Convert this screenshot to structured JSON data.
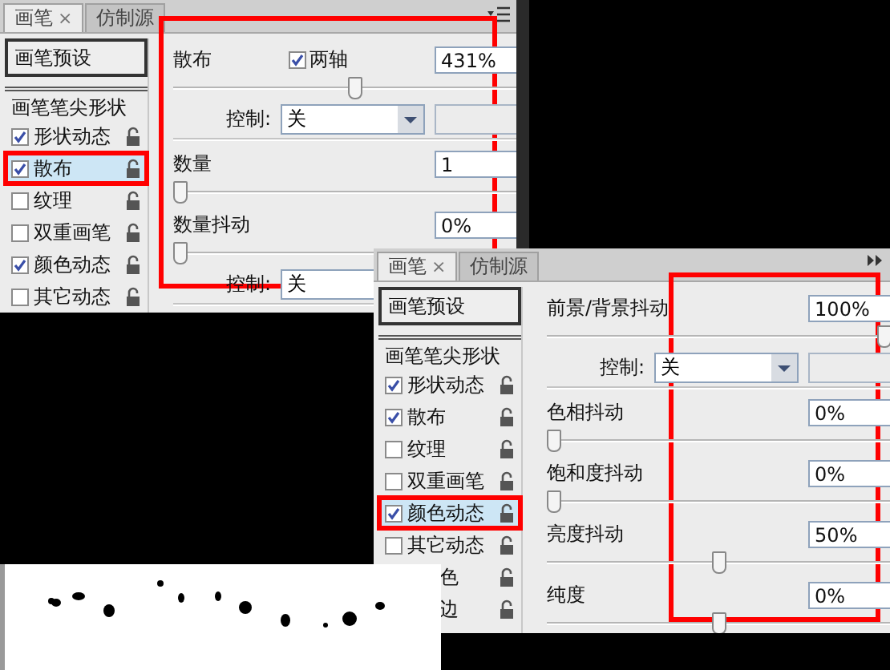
{
  "panels": [
    {
      "tabs": [
        {
          "label": "画笔",
          "close": "×",
          "selected": true
        },
        {
          "label": "仿制源",
          "selected": false
        }
      ],
      "options": [
        {
          "kind": "preset",
          "label": "画笔预设"
        },
        {
          "kind": "tip",
          "label": "画笔笔尖形状"
        },
        {
          "kind": "option",
          "label": "形状动态",
          "checked": true,
          "selected": false,
          "marked": false
        },
        {
          "kind": "option",
          "label": "散布",
          "checked": true,
          "selected": true,
          "marked": true
        },
        {
          "kind": "option",
          "label": "纹理",
          "checked": false,
          "selected": false,
          "marked": false
        },
        {
          "kind": "option",
          "label": "双重画笔",
          "checked": false,
          "selected": false,
          "marked": false
        },
        {
          "kind": "option",
          "label": "颜色动态",
          "checked": true,
          "selected": false,
          "marked": false
        },
        {
          "kind": "option",
          "label": "其它动态",
          "checked": false,
          "selected": false,
          "marked": false
        }
      ],
      "settings": [
        {
          "kind": "slider",
          "label": "散布",
          "option": {
            "label": "两轴",
            "checked": true
          },
          "value": "431%",
          "level": 0.53
        },
        {
          "kind": "control",
          "label": "控制:",
          "value": "关"
        },
        {
          "kind": "slider",
          "label": "数量",
          "value": "1",
          "level": 0
        },
        {
          "kind": "slider",
          "label": "数量抖动",
          "value": "0%",
          "level": 0
        },
        {
          "kind": "cut_control",
          "label": "控制:",
          "value": "关"
        }
      ]
    },
    {
      "tabs": [
        {
          "label": "画笔",
          "close": "×",
          "selected": true
        },
        {
          "label": "仿制源",
          "selected": false
        }
      ],
      "options": [
        {
          "kind": "preset",
          "label": "画笔预设"
        },
        {
          "kind": "tip",
          "label": "画笔笔尖形状"
        },
        {
          "kind": "option",
          "label": "形状动态",
          "checked": true,
          "selected": false,
          "marked": false
        },
        {
          "kind": "option",
          "label": "散布",
          "checked": true,
          "selected": false,
          "marked": false
        },
        {
          "kind": "option",
          "label": "纹理",
          "checked": false,
          "selected": false,
          "marked": false
        },
        {
          "kind": "option",
          "label": "双重画笔",
          "checked": false,
          "selected": false,
          "marked": false
        },
        {
          "kind": "option",
          "label": "颜色动态",
          "checked": true,
          "selected": true,
          "marked": true
        },
        {
          "kind": "option",
          "label": "其它动态",
          "checked": false,
          "selected": false,
          "marked": false
        },
        {
          "kind": "partial",
          "label": "色"
        },
        {
          "kind": "partial",
          "label": "边"
        }
      ],
      "settings": [
        {
          "kind": "slider",
          "label": "前景/背景抖动",
          "value": "100%",
          "level": 1
        },
        {
          "kind": "control",
          "label": "控制:",
          "value": "关"
        },
        {
          "kind": "slider",
          "label": "色相抖动",
          "value": "0%",
          "level": 0
        },
        {
          "kind": "slider",
          "label": "饱和度抖动",
          "value": "0%",
          "level": 0
        },
        {
          "kind": "slider",
          "label": "亮度抖动",
          "value": "50%",
          "level": 0.5
        },
        {
          "kind": "slider",
          "label": "纯度",
          "value": "0%",
          "level": 0.5
        }
      ]
    }
  ]
}
